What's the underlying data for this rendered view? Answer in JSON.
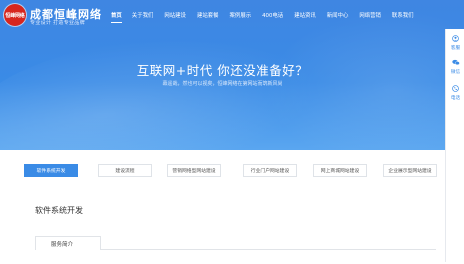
{
  "header": {
    "logo_text": "恒峰网络",
    "brand_name": "成都恒峰网络",
    "tagline": "专业设计 打造专业品牌"
  },
  "nav": {
    "items": [
      {
        "label": "首页",
        "active": true
      },
      {
        "label": "关于我们",
        "active": false
      },
      {
        "label": "网站建设",
        "active": false
      },
      {
        "label": "建站套餐",
        "active": false
      },
      {
        "label": "案例展示",
        "active": false
      },
      {
        "label": "400电话",
        "active": false
      },
      {
        "label": "建站资讯",
        "active": false
      },
      {
        "label": "新闻中心",
        "active": false
      },
      {
        "label": "网络营销",
        "active": false
      },
      {
        "label": "联系我们",
        "active": false
      }
    ]
  },
  "side_panel": {
    "items": [
      {
        "icon": "user-icon",
        "label": "客服"
      },
      {
        "icon": "wechat-icon",
        "label": "微信"
      },
      {
        "icon": "phone-icon",
        "label": "电话"
      }
    ]
  },
  "hero": {
    "title": "互联网+时代 你还没准备好？",
    "subtitle": "幕遥哉，然也可以视矣，恒峰网络在第网站而筑新风尚"
  },
  "tabs": [
    {
      "label": "软件系统开发",
      "active": true
    },
    {
      "label": "建设流程",
      "active": false
    },
    {
      "label": "营销网络型网站建设",
      "active": false
    },
    {
      "label": "行业门户网站建设",
      "active": false
    },
    {
      "label": "网上商城网站建设",
      "active": false
    },
    {
      "label": "企业展示型网站建设",
      "active": false
    }
  ],
  "section": {
    "title": "软件系统开发",
    "sub_tab": "服务简介"
  },
  "colors": {
    "primary": "#3a8be6",
    "logo_red": "#d7261e"
  }
}
